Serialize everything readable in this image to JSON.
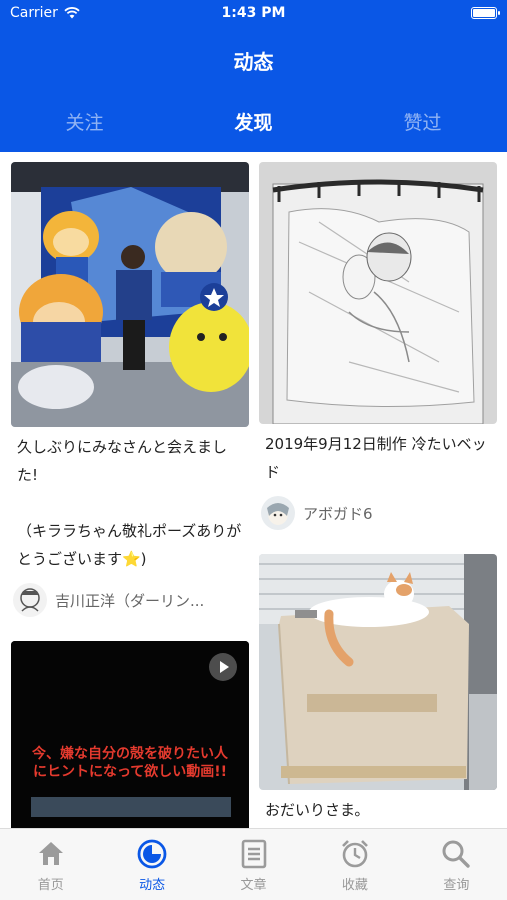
{
  "status": {
    "carrier": "Carrier",
    "time": "1:43 PM"
  },
  "header": {
    "title": "动态",
    "tabs": [
      {
        "label": "关注",
        "active": false
      },
      {
        "label": "发现",
        "active": true
      },
      {
        "label": "赞过",
        "active": false
      }
    ]
  },
  "feed": {
    "cards": [
      {
        "column": "left",
        "image_desc": "mascot-photo",
        "caption": "久しぶりにみなさんと会えました!\n\n（キララちゃん敬礼ポーズありがとうございます⭐️)",
        "author": "吉川正洋（ダーリン..."
      },
      {
        "column": "left",
        "image_desc": "video-thumbnail",
        "overlay_text": "今、嫌な自分の殻を破りたい人にヒントになって欲しい動画!!"
      },
      {
        "column": "right",
        "image_desc": "bed-illustration",
        "caption": "2019年9月12日制作  冷たいベッド",
        "author": "アボガド6"
      },
      {
        "column": "right",
        "image_desc": "cat-box-photo",
        "caption": "おだいりさま。"
      }
    ]
  },
  "tabbar": {
    "items": [
      {
        "label": "首页",
        "icon": "home-icon",
        "active": false
      },
      {
        "label": "动态",
        "icon": "moments-icon",
        "active": true
      },
      {
        "label": "文章",
        "icon": "article-icon",
        "active": false
      },
      {
        "label": "收藏",
        "icon": "alarm-clock-icon",
        "active": false
      },
      {
        "label": "查询",
        "icon": "search-icon",
        "active": false
      }
    ]
  },
  "colors": {
    "brand": "#0a57e6",
    "inactive": "#999999"
  }
}
